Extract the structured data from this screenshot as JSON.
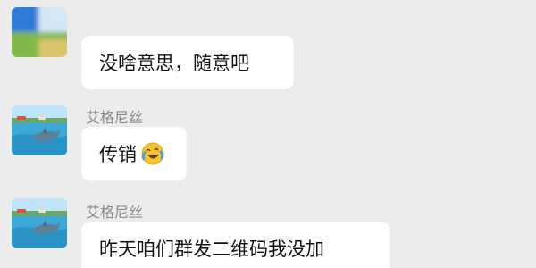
{
  "messages": [
    {
      "sender": "",
      "text": "没啥意思，随意吧",
      "emoji": null
    },
    {
      "sender": "艾格尼丝",
      "text": "传销",
      "emoji": "laughing-crying-emoji"
    },
    {
      "sender": "艾格尼丝",
      "text": "昨天咱们群发二维码我没加",
      "emoji": null
    }
  ],
  "colors": {
    "background": "#ececec",
    "bubble": "#ffffff",
    "sender_text": "#8a8a8a",
    "message_text": "#111111"
  }
}
